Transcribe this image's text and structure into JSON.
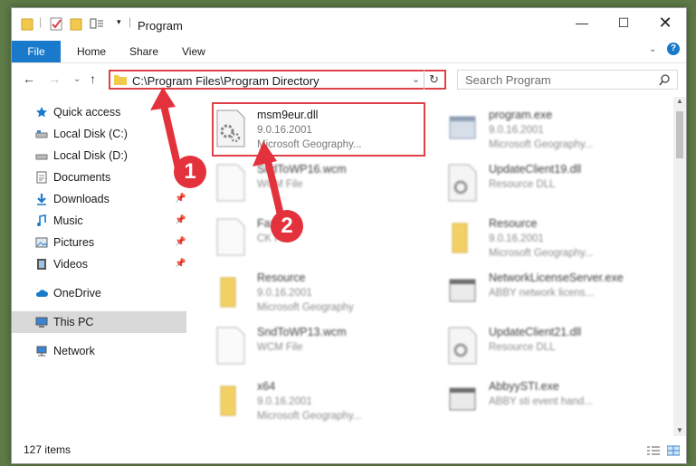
{
  "window": {
    "title": "Program",
    "minimize_icon": "minimize-icon",
    "maximize_icon": "maximize-icon",
    "close_icon": "close-icon"
  },
  "ribbon": {
    "tabs": [
      "File",
      "Home",
      "Share",
      "View"
    ],
    "accent": "#1979ca"
  },
  "navigation": {
    "back_icon": "back-arrow-icon",
    "forward_icon": "forward-arrow-icon",
    "recent_icon": "chevron-down-icon",
    "up_icon": "up-arrow-icon",
    "address_path": "C:\\Program Files\\Program Directory",
    "search_placeholder": "Search Program",
    "highlight_color": "#e04148"
  },
  "sidebar": {
    "items": [
      {
        "label": "Quick access",
        "icon": "star-icon"
      },
      {
        "label": "Local Disk (C:)",
        "icon": "drive-icon"
      },
      {
        "label": "Local Disk (D:)",
        "icon": "drive-icon"
      },
      {
        "label": "Documents",
        "icon": "documents-icon"
      },
      {
        "label": "Downloads",
        "icon": "download-icon"
      },
      {
        "label": "Music",
        "icon": "music-icon"
      },
      {
        "label": "Pictures",
        "icon": "pictures-icon"
      },
      {
        "label": "Videos",
        "icon": "videos-icon"
      },
      {
        "label": "OneDrive",
        "icon": "cloud-icon"
      },
      {
        "label": "This PC",
        "icon": "computer-icon"
      },
      {
        "label": "Network",
        "icon": "network-icon"
      }
    ]
  },
  "files": [
    {
      "name": "msm9eur.dll",
      "line2": "9.0.16.2001",
      "line3": "Microsoft Geography...",
      "icon": "dll-gear-icon",
      "blurred": false
    },
    {
      "name": "program.exe",
      "line2": "9.0.16.2001",
      "line3": "Microsoft Geography...",
      "icon": "exe-icon",
      "blurred": true
    },
    {
      "name": "SndToWP16.wcm",
      "line2": "WCM File",
      "line3": "",
      "icon": "file-icon",
      "blurred": true
    },
    {
      "name": "UpdateClient19.dll",
      "line2": "Resource DLL",
      "line3": "",
      "icon": "dll-gear-icon",
      "blurred": true
    },
    {
      "name": "Fax.bk",
      "line2": "CK File",
      "line3": "",
      "icon": "file-icon",
      "blurred": true
    },
    {
      "name": "Resource",
      "line2": "9.0.16.2001",
      "line3": "Microsoft Geography...",
      "icon": "folder-icon",
      "blurred": true
    },
    {
      "name": "Resource",
      "line2": "9.0.16.2001",
      "line3": "Microsoft Geography",
      "icon": "folder-icon",
      "blurred": true
    },
    {
      "name": "NetworkLicenseServer.exe",
      "line2": "ABBY network licens...",
      "line3": "",
      "icon": "exe-icon",
      "blurred": true
    },
    {
      "name": "SndToWP13.wcm",
      "line2": "WCM File",
      "line3": "",
      "icon": "file-icon",
      "blurred": true
    },
    {
      "name": "UpdateClient21.dll",
      "line2": "Resource DLL",
      "line3": "",
      "icon": "dll-gear-icon",
      "blurred": true
    },
    {
      "name": "x64",
      "line2": "9.0.16.2001",
      "line3": "Microsoft Geography...",
      "icon": "folder-icon",
      "blurred": true
    },
    {
      "name": "AbbyySTI.exe",
      "line2": "ABBY sti event hand...",
      "line3": "",
      "icon": "exe-icon",
      "blurred": true
    }
  ],
  "status": {
    "count": "127 items"
  },
  "annotations": [
    {
      "number": "1"
    },
    {
      "number": "2"
    }
  ]
}
